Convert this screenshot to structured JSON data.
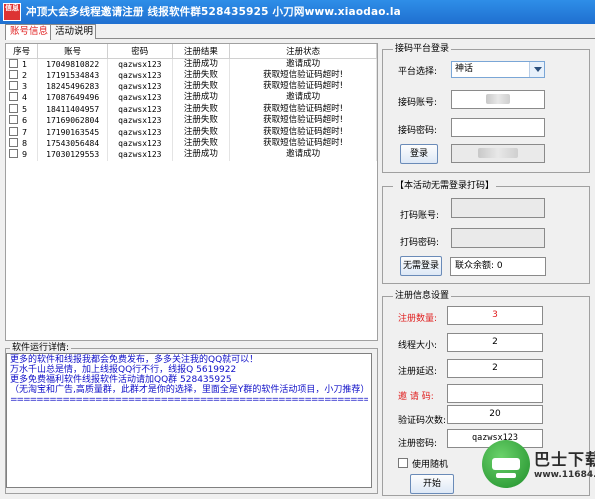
{
  "window": {
    "icon_text": "信息",
    "title": "冲顶大会多线程邀请注册    线报软件群528435925    小刀网www.xiaodao.la"
  },
  "tabs": [
    {
      "label": "账号信息"
    },
    {
      "label": "活动说明"
    }
  ],
  "table": {
    "headers": [
      "序号",
      "账号",
      "密码",
      "注册结果",
      "注册状态"
    ],
    "rows": [
      {
        "idx": "1",
        "account": "17049810822",
        "password": "qazwsx123",
        "result": "注册成功",
        "status": "邀请成功"
      },
      {
        "idx": "2",
        "account": "17191534843",
        "password": "qazwsx123",
        "result": "注册失败",
        "status": "获取短信验证码超时!"
      },
      {
        "idx": "3",
        "account": "18245496283",
        "password": "qazwsx123",
        "result": "注册失败",
        "status": "获取短信验证码超时!"
      },
      {
        "idx": "4",
        "account": "17087649496",
        "password": "qazwsx123",
        "result": "注册成功",
        "status": "邀请成功"
      },
      {
        "idx": "5",
        "account": "18411404957",
        "password": "qazwsx123",
        "result": "注册失败",
        "status": "获取短信验证码超时!"
      },
      {
        "idx": "6",
        "account": "17169062804",
        "password": "qazwsx123",
        "result": "注册失败",
        "status": "获取短信验证码超时!"
      },
      {
        "idx": "7",
        "account": "17190163545",
        "password": "qazwsx123",
        "result": "注册失败",
        "status": "获取短信验证码超时!"
      },
      {
        "idx": "8",
        "account": "17543056484",
        "password": "qazwsx123",
        "result": "注册失败",
        "status": "获取短信验证码超时!"
      },
      {
        "idx": "9",
        "account": "17030129553",
        "password": "qazwsx123",
        "result": "注册成功",
        "status": "邀请成功"
      }
    ]
  },
  "log": {
    "label": "软件运行详情:",
    "lines": [
      "更多的软件和线报我都会免费发布，多多关注我的QQ就可以！",
      "万水千山总是情，加上线报QQ行不行，线报Q 5619922",
      "更多免费福利软件线报软件活动请加QQ群 528435925",
      "（无淘宝和广告,高质量群，此群才是你的选择，里面全是Y群的软件活动项目，小刀推荐）",
      "==============================================================================="
    ]
  },
  "platform_login": {
    "title": "接码平台登录",
    "platform_label": "平台选择:",
    "platform_value": "神话",
    "account_label": "接码账号:",
    "password_label": "接码密码:",
    "login_button": "登录"
  },
  "captcha": {
    "title": "【本活动无需登录打码】",
    "account_label": "打码账号:",
    "password_label": "打码密码:",
    "no_login_button": "无需登录",
    "balance_text": "联众余额: 0"
  },
  "settings": {
    "title": "注册信息设置",
    "count_label": "注册数量:",
    "count_value": "3",
    "threads_label": "线程大小:",
    "threads_value": "2",
    "delay_label": "注册延迟:",
    "delay_value": "2",
    "invite_label": "邀 请 码:",
    "invite_value": "",
    "retry_label": "验证码次数:",
    "retry_value": "20",
    "password_label": "注册密码:",
    "password_value": "qazwsx123",
    "random_label": "使用随机",
    "start_button": "开始"
  },
  "watermark": {
    "text": "巴士下载",
    "url": "www.11684.com"
  }
}
